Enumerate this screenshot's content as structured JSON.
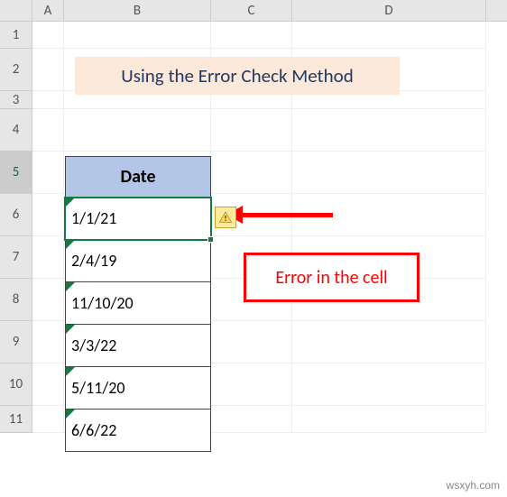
{
  "columns": [
    "A",
    "B",
    "C",
    "D"
  ],
  "rows": [
    "1",
    "2",
    "3",
    "4",
    "5",
    "6",
    "7",
    "8",
    "9",
    "10",
    "11"
  ],
  "selectedRow": "5",
  "title": "Using the Error Check Method",
  "table": {
    "header": "Date",
    "values": [
      "1/1/21",
      "2/4/19",
      "11/10/20",
      "3/3/22",
      "5/11/20",
      "6/6/22"
    ]
  },
  "callout": "Error in the cell",
  "errorIcon": "warning-icon",
  "watermark": "wsxyh.com"
}
